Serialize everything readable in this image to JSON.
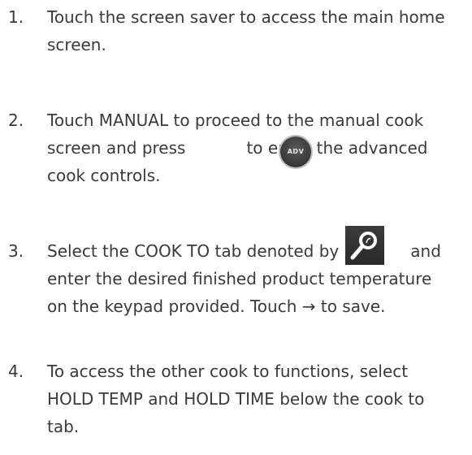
{
  "steps": [
    {
      "number": "1.",
      "lines": [
        "Touch the screen saver to access the main home",
        "screen."
      ]
    },
    {
      "number": "2.",
      "line1": "Touch MANUAL to proceed to the manual cook",
      "line2_before": "screen and press",
      "line2_after": "to enter the advanced",
      "line3": "cook controls.",
      "icon_label": "ADV"
    },
    {
      "number": "3.",
      "line1_before": "Select the COOK TO tab denoted by",
      "line1_after": "and",
      "line2": "enter the desired finished product temperature",
      "line3": "on the keypad provided. Touch → to save."
    },
    {
      "number": "4.",
      "lines": [
        "To access the other cook to functions, select",
        "HOLD TEMP and HOLD TIME below the cook to",
        "tab."
      ]
    }
  ],
  "icons": {
    "adv": "adv-button-icon",
    "cook_to": "temperature-probe-icon"
  },
  "colors": {
    "text": "#3a3a3a",
    "icon_dark": "#2a2a2a"
  }
}
